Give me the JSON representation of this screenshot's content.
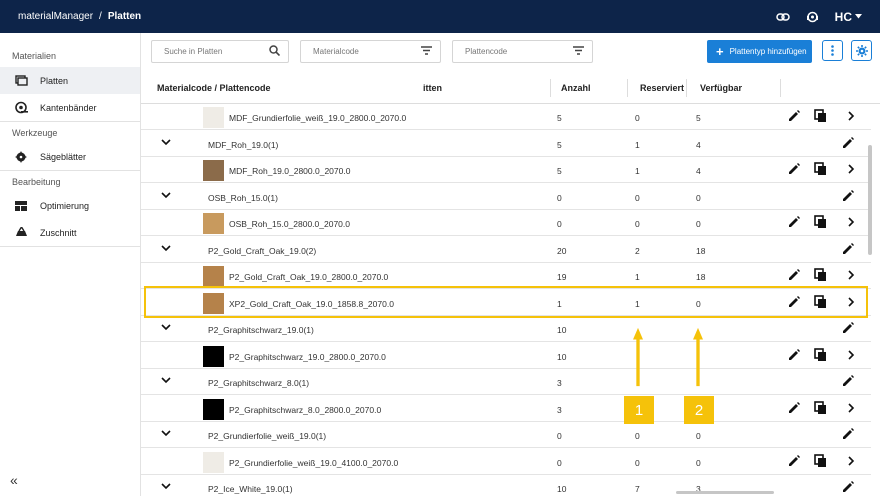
{
  "header": {
    "app": "materialManager",
    "separator": "/",
    "page": "Platten",
    "logo_text": "HC"
  },
  "sidebar": {
    "sections": [
      {
        "title": "Materialien",
        "items": [
          {
            "label": "Platten",
            "icon": "monitor-icon",
            "active": true
          },
          {
            "label": "Kantenbänder",
            "icon": "tape-roll-icon"
          }
        ]
      },
      {
        "title": "Werkzeuge",
        "items": [
          {
            "label": "Sägeblätter",
            "icon": "saw-blade-icon"
          }
        ]
      },
      {
        "title": "Bearbeitung",
        "items": [
          {
            "label": "Optimierung",
            "icon": "layout-icon"
          },
          {
            "label": "Zuschnitt",
            "icon": "cut-icon"
          }
        ]
      }
    ],
    "collapse": "«"
  },
  "toolbar": {
    "search_placeholder": "Suche in Platten",
    "filter1": "Materialcode",
    "filter2": "Plattencode",
    "add_label": "Plattentyp hinzufügen"
  },
  "table": {
    "headers": {
      "code": "Materialcode / Plattencode",
      "mid": "itten",
      "count": "Anzahl",
      "reserved": "Reserviert",
      "available": "Verfügbar"
    },
    "rows": [
      {
        "kind": "child",
        "code": "MDF_Grundierfolie_weiß_19.0_2800.0_2070.0",
        "count": "5",
        "reserved": "0",
        "available": "5",
        "swatch": "#efece6"
      },
      {
        "kind": "group",
        "code": "MDF_Roh_19.0(1)",
        "count": "5",
        "reserved": "1",
        "available": "4"
      },
      {
        "kind": "child",
        "code": "MDF_Roh_19.0_2800.0_2070.0",
        "count": "5",
        "reserved": "1",
        "available": "4",
        "swatch": "#8b6b4a"
      },
      {
        "kind": "group",
        "code": "OSB_Roh_15.0(1)",
        "count": "0",
        "reserved": "0",
        "available": "0"
      },
      {
        "kind": "child",
        "code": "OSB_Roh_15.0_2800.0_2070.0",
        "count": "0",
        "reserved": "0",
        "available": "0",
        "swatch": "#c89a5e"
      },
      {
        "kind": "group",
        "code": "P2_Gold_Craft_Oak_19.0(2)",
        "count": "20",
        "reserved": "2",
        "available": "18"
      },
      {
        "kind": "child",
        "code": "P2_Gold_Craft_Oak_19.0_2800.0_2070.0",
        "count": "19",
        "reserved": "1",
        "available": "18",
        "swatch": "#b5824a"
      },
      {
        "kind": "child",
        "code": "XP2_Gold_Craft_Oak_19.0_1858.8_2070.0",
        "count": "1",
        "reserved": "1",
        "available": "0",
        "swatch": "#b5824a"
      },
      {
        "kind": "group",
        "code": "P2_Graphitschwarz_19.0(1)",
        "count": "10",
        "reserved": "",
        "available": ""
      },
      {
        "kind": "child",
        "code": "P2_Graphitschwarz_19.0_2800.0_2070.0",
        "count": "10",
        "reserved": "",
        "available": "",
        "swatch": "#000000"
      },
      {
        "kind": "group",
        "code": "P2_Graphitschwarz_8.0(1)",
        "count": "3",
        "reserved": "",
        "available": ""
      },
      {
        "kind": "child",
        "code": "P2_Graphitschwarz_8.0_2800.0_2070.0",
        "count": "3",
        "reserved": "",
        "available": "",
        "swatch": "#000000"
      },
      {
        "kind": "group",
        "code": "P2_Grundierfolie_weiß_19.0(1)",
        "count": "0",
        "reserved": "0",
        "available": "0"
      },
      {
        "kind": "child",
        "code": "P2_Grundierfolie_weiß_19.0_4100.0_2070.0",
        "count": "0",
        "reserved": "0",
        "available": "0",
        "swatch": "#efece6"
      },
      {
        "kind": "group",
        "code": "P2_Ice_White_19.0(1)",
        "count": "10",
        "reserved": "7",
        "available": "3"
      }
    ]
  },
  "callouts": [
    "1",
    "2"
  ],
  "colors": {
    "header": "#0d2449",
    "accent": "#1a7fd7",
    "highlight": "#f5c20a"
  }
}
